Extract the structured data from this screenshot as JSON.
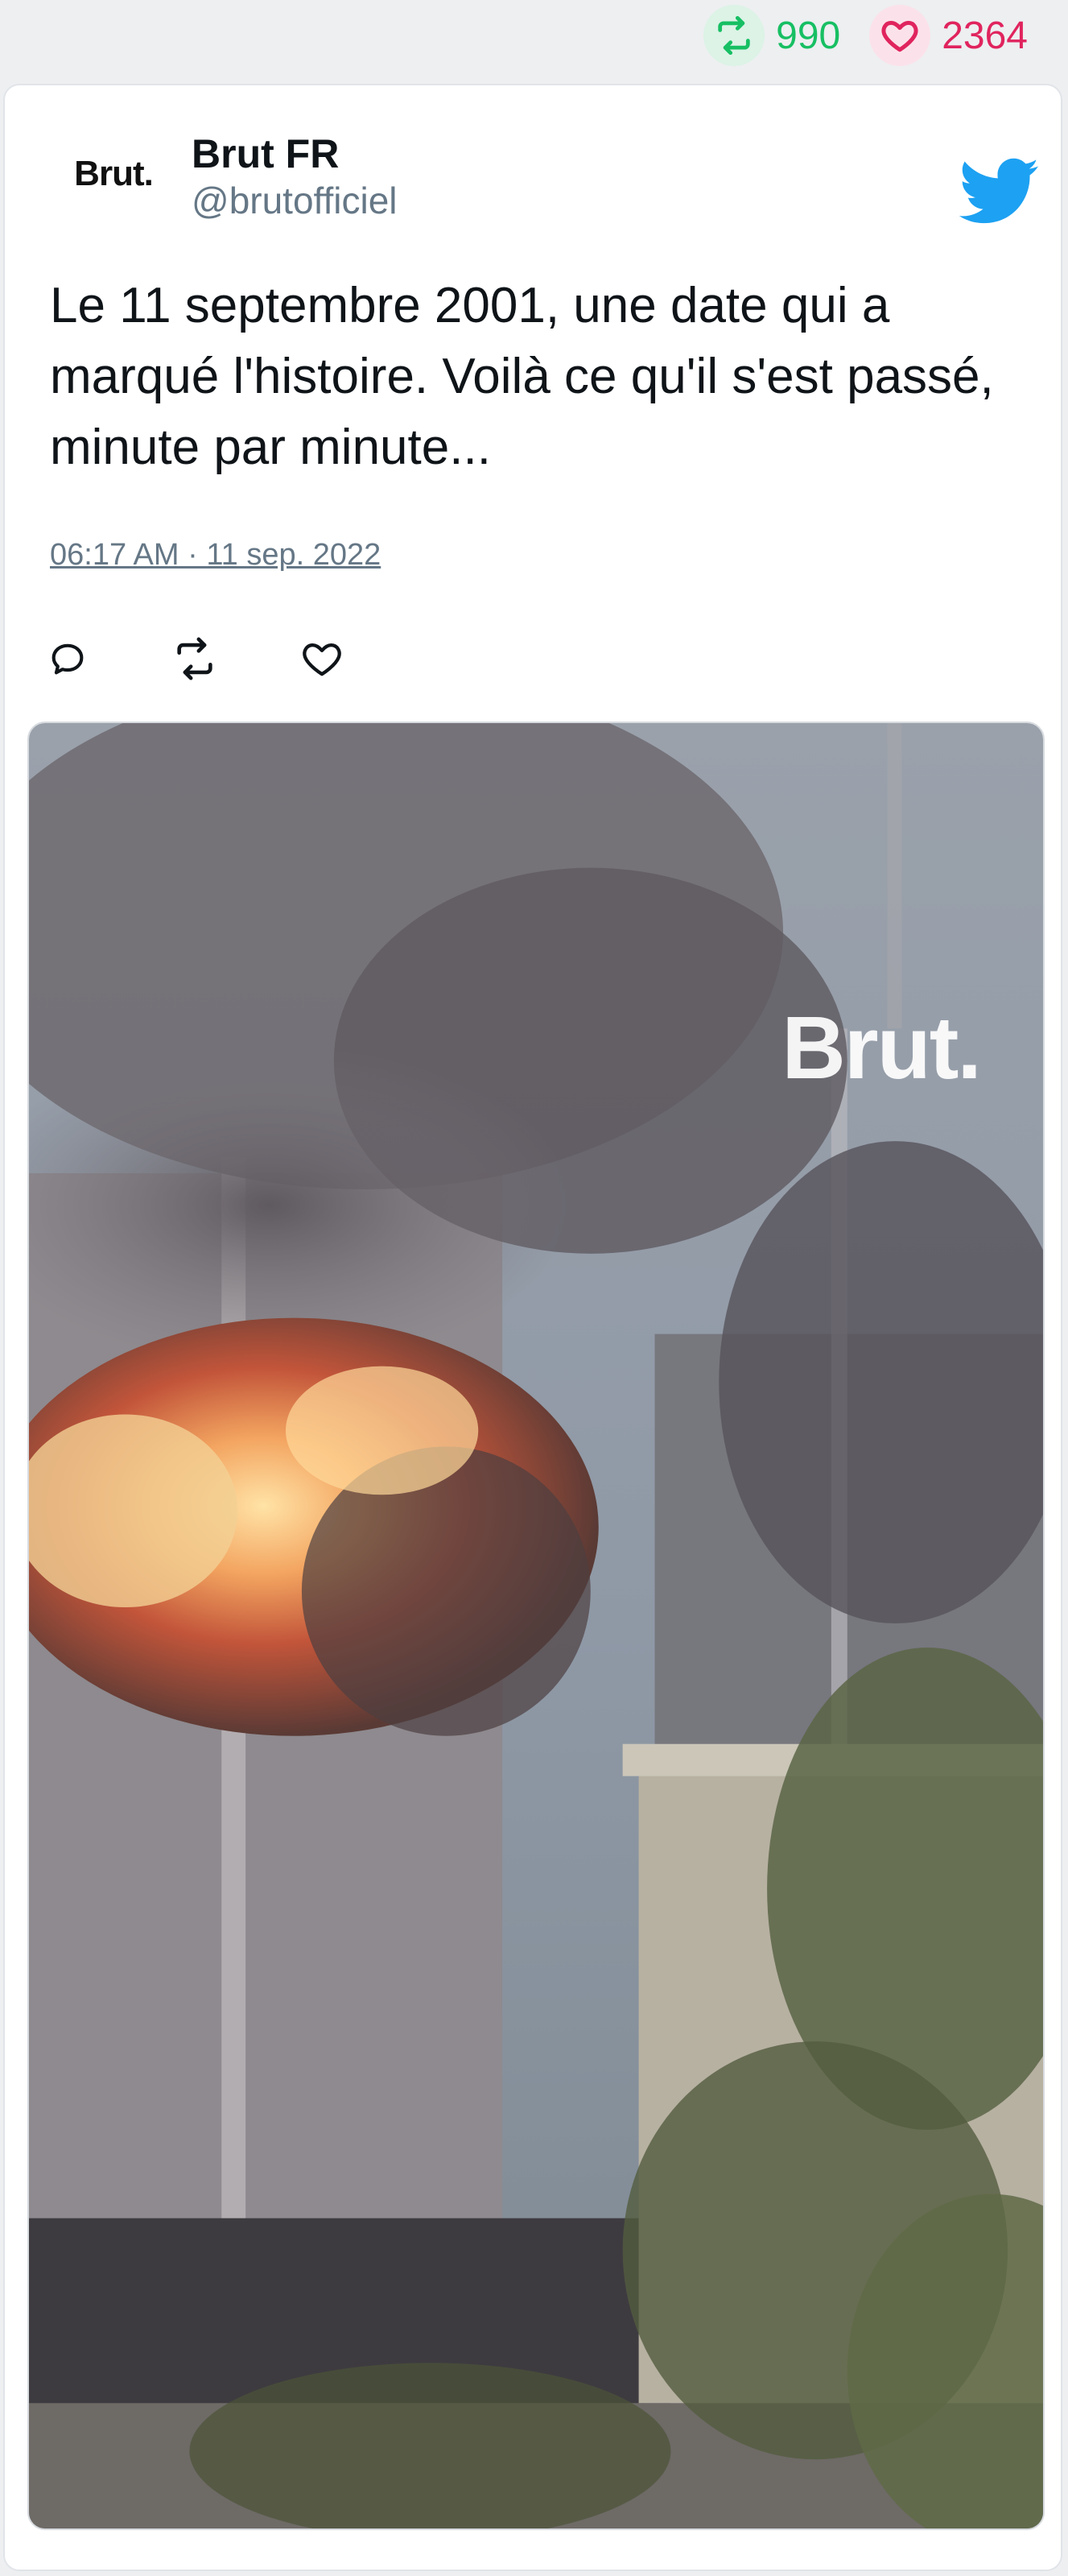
{
  "stats": {
    "retweets": "990",
    "likes": "2364"
  },
  "tweet": {
    "avatar_text": "Brut.",
    "name": "Brut FR",
    "handle": "@brutofficiel",
    "text": "Le 11 septembre 2001, une date qui a marqué l'histoire. Voilà ce qu'il s'est passé, minute par minute...",
    "timestamp": "06:17 AM · 11 sep. 2022",
    "media_watermark": "Brut."
  },
  "icons": {
    "retweet": "retweet-icon",
    "like": "heart-icon",
    "reply": "reply-icon",
    "twitter": "twitter-bird-icon"
  },
  "colors": {
    "retweet": "#17bf63",
    "like": "#e0245e",
    "twitter_blue": "#1da1f2"
  }
}
